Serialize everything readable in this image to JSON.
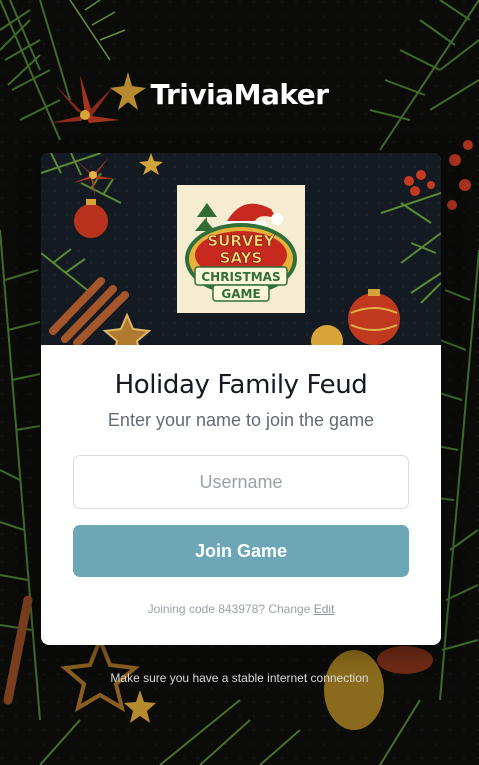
{
  "app": {
    "brand": "TriviaMaker"
  },
  "game": {
    "logo_lines": [
      "SURVEY",
      "SAYS",
      "CHRISTMAS",
      "GAME"
    ],
    "title": "Holiday Family Feud",
    "subtitle": "Enter your name to join the game"
  },
  "form": {
    "username_placeholder": "Username",
    "username_value": "",
    "join_label": "Join Game"
  },
  "joining": {
    "text": "Joining code 843978? Change",
    "edit_label": "Edit"
  },
  "footer": {
    "note": "Make sure you have a stable internet connection"
  },
  "colors": {
    "button": "#6da7b6",
    "background": "#0b0c0a",
    "banner": "#131a22",
    "title": "#151a22"
  },
  "icons": [
    "christmas-background-decoration",
    "christmas-banner-decoration",
    "survey-says-logo"
  ]
}
